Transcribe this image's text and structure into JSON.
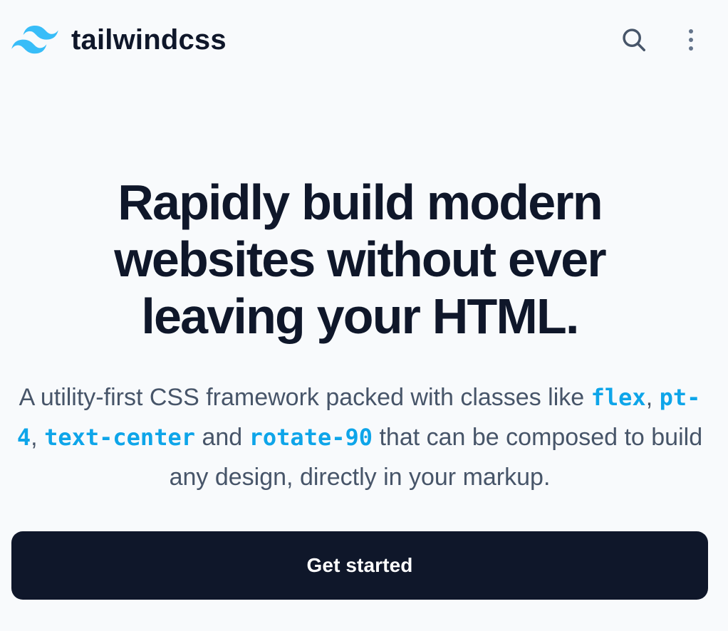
{
  "header": {
    "brand": "tailwindcss",
    "logo_icon": "tailwind-logo-icon",
    "search_icon": "search-icon",
    "menu_icon": "vertical-ellipsis-icon"
  },
  "hero": {
    "title_lines": [
      "Rapidly build modern",
      "websites without ever",
      "leaving your HTML."
    ],
    "description": {
      "intro": "A utility-first CSS framework packed with classes like",
      "code_1": "flex",
      "separator_1": ",",
      "code_2": "pt-4",
      "separator_2": ",",
      "code_3": "text-center",
      "connector": "and",
      "code_4": "rotate-90",
      "outro": "that can be composed to build any design, directly in your markup."
    },
    "cta_label": "Get started"
  },
  "colors": {
    "background": "#f8fafc",
    "text": "#0f172a",
    "muted_text": "#475569",
    "accent": "#0ea5e9",
    "button": "#0f172a",
    "button_text": "#ffffff"
  }
}
